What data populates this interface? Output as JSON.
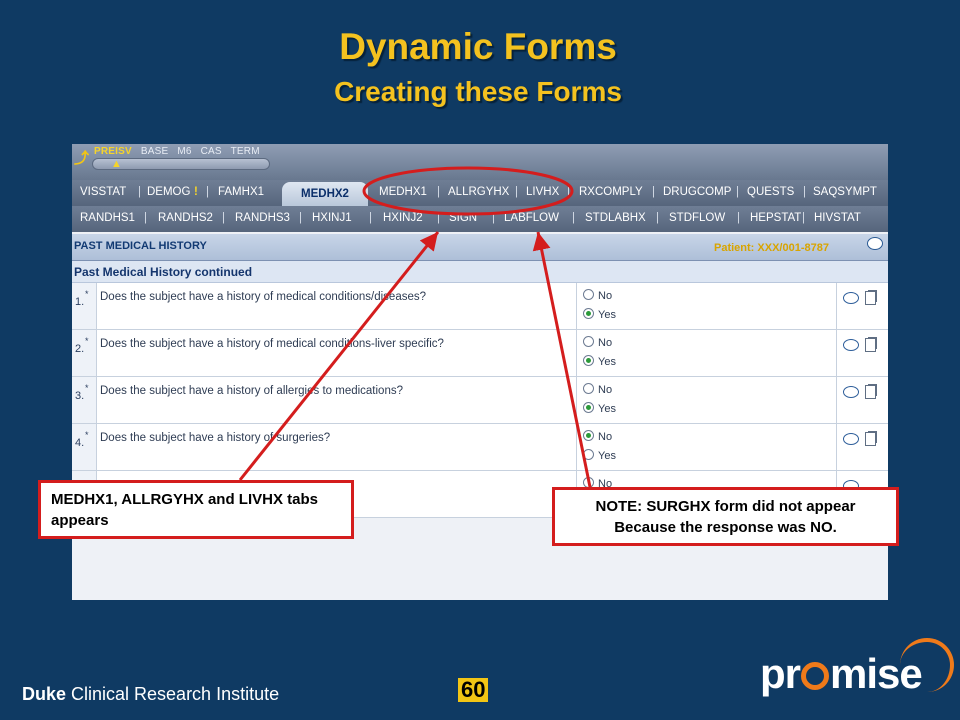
{
  "slide": {
    "title": "Dynamic Forms",
    "subtitle": "Creating these Forms",
    "page_number": "60",
    "org_bold": "Duke",
    "org_rest": " Clinical Research Institute",
    "logo_pre": "pr",
    "logo_post": "mise"
  },
  "app": {
    "top_nav": [
      "PREISV",
      "BASE",
      "M6",
      "CAS",
      "TERM"
    ],
    "active_nav": "PREISV",
    "tabs_row1": [
      "VISSTAT",
      "DEMOG",
      "FAMHX1",
      "MEDHX1",
      "ALLRGYHX",
      "LIVHX",
      "RXCOMPLY",
      "DRUGCOMP",
      "QUESTS",
      "SAQSYMPT"
    ],
    "demog_flag": "!",
    "active_tab": "MEDHX2",
    "tabs_row2": [
      "RANDHS1",
      "RANDHS2",
      "RANDHS3",
      "HXINJ1",
      "HXINJ2",
      "SIGN",
      "LABFLOW",
      "STDLABHX",
      "STDFLOW",
      "HEPSTAT",
      "HIVSTAT"
    ],
    "section_title": "PAST MEDICAL HISTORY",
    "patient": "Patient: XXX/001-8787",
    "subheader": "Past Medical History continued",
    "required_mark": "*",
    "questions": [
      {
        "num": "1.",
        "text": "Does the subject have a history of medical conditions/diseases?",
        "options": [
          "No",
          "Yes"
        ],
        "selected": "Yes"
      },
      {
        "num": "2.",
        "text": "Does the subject have a history of medical conditions-liver specific?",
        "options": [
          "No",
          "Yes"
        ],
        "selected": "Yes"
      },
      {
        "num": "3.",
        "text": "Does the subject have a history of allergies to medications?",
        "options": [
          "No",
          "Yes"
        ],
        "selected": "Yes"
      },
      {
        "num": "4.",
        "text": "Does the subject have a history of surgeries?",
        "options": [
          "No",
          "Yes"
        ],
        "selected": "No"
      },
      {
        "num": "",
        "text": "",
        "options": [
          "No"
        ],
        "selected": ""
      }
    ]
  },
  "callouts": {
    "left": "MEDHX1, ALLRGYHX and LIVHX tabs appears",
    "right_line1": "NOTE: SURGHX form did not appear",
    "right_line2": "Because the response was NO."
  },
  "colors": {
    "background": "#0f3a63",
    "title": "#f4c21f",
    "annotation_red": "#d41d1d",
    "logo_orange": "#ef7a1a"
  }
}
